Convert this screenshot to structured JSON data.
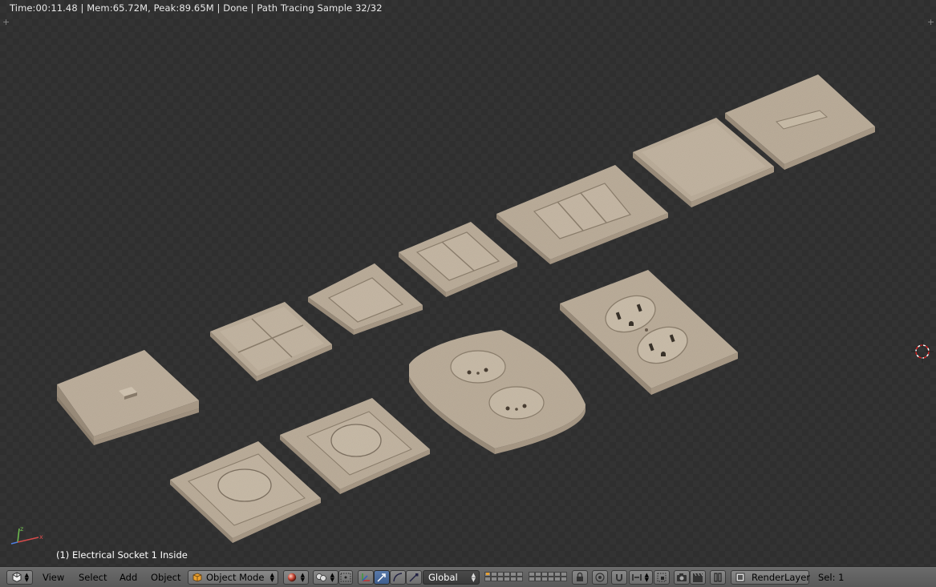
{
  "status_bar": {
    "text": "Time:00:11.48 | Mem:65.72M, Peak:89.65M | Done | Path Tracing Sample 32/32"
  },
  "viewport": {
    "object_label": "(1) Electrical Socket 1 Inside"
  },
  "header": {
    "menu": {
      "view": "View",
      "select": "Select",
      "add": "Add",
      "object": "Object"
    },
    "mode": {
      "label": "Object Mode",
      "icon": "cube-icon"
    },
    "shading_icon": "sphere-shading-icon",
    "pivot_icon": "pivot-point-icon",
    "orientation": {
      "label": "Global"
    },
    "render_layer": {
      "label": "RenderLayer"
    },
    "selection": {
      "label": "Sel: 1"
    }
  },
  "colors": {
    "viewport_dark": "#2f2f2f",
    "viewport_light": "#333333",
    "plate": "#b8aa98",
    "plate_edge": "#9a8c7a",
    "header": "#636363",
    "text_light": "#e8e8e8"
  }
}
